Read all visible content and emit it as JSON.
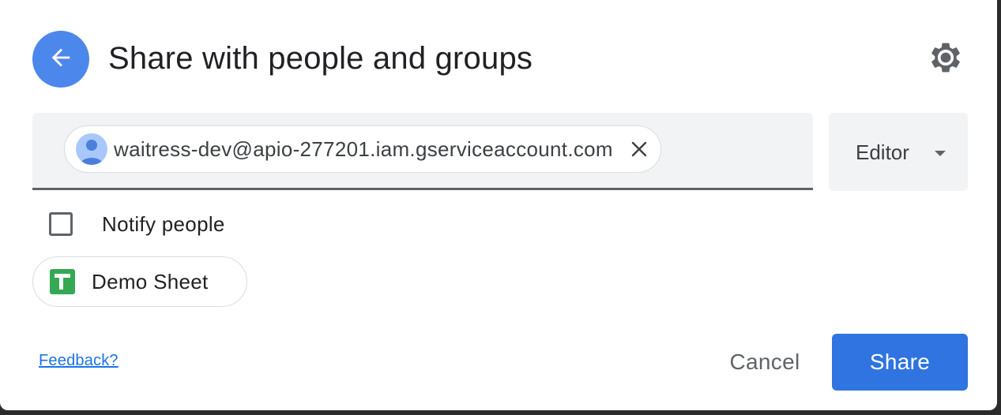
{
  "dialog": {
    "title": "Share with people and groups",
    "back_icon": "arrow-left-icon",
    "settings_icon": "gear-icon"
  },
  "recipient": {
    "email": "waitress-dev@apio-277201.iam.gserviceaccount.com",
    "avatar_icon": "person-icon",
    "remove_icon": "close-icon"
  },
  "role": {
    "selected": "Editor",
    "caret_icon": "caret-down-icon"
  },
  "notify": {
    "label": "Notify people",
    "checked": false
  },
  "file": {
    "name": "Demo Sheet",
    "icon": "google-sheets-icon"
  },
  "footer": {
    "feedback_label": "Feedback?",
    "cancel_label": "Cancel",
    "share_label": "Share"
  },
  "colors": {
    "accent": "#2f74e0",
    "back_button": "#4c87ec",
    "sheets_green": "#34a853",
    "link": "#1a73e8"
  }
}
